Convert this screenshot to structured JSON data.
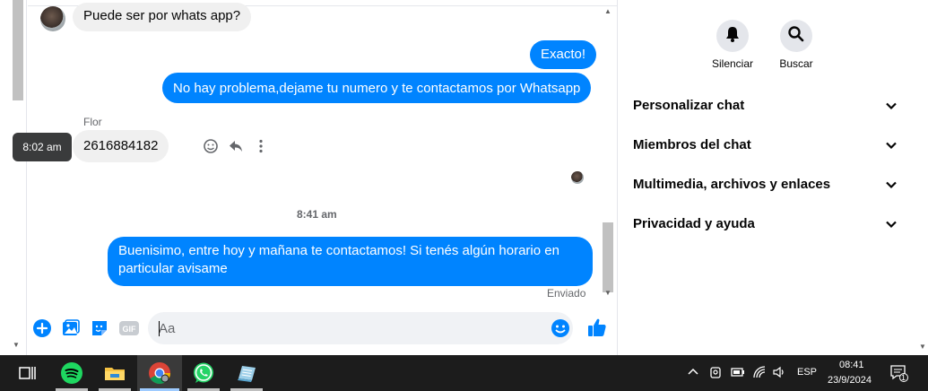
{
  "messages": {
    "in_first": "Puede ser por whats app?",
    "out_exacto": "Exacto!",
    "out_no_problema": "No hay problema,dejame tu numero y te contactamos por Whatsapp",
    "sender_flor": "Flor",
    "in_number": "2616884182",
    "tooltip_time": "8:02 am",
    "timestamp": "8:41 am",
    "out_last_line1": "Buenisimo, entre hoy y mañana te contactamos! Si tenés algún horario en",
    "out_last_line2": "particular avisame",
    "status": "Enviado"
  },
  "composer": {
    "placeholder": "Aa",
    "gif_label": "GIF"
  },
  "sidebar": {
    "mute_label": "Silenciar",
    "search_label": "Buscar",
    "items": [
      {
        "label": "Personalizar chat"
      },
      {
        "label": "Miembros del chat"
      },
      {
        "label": "Multimedia, archivos y enlaces"
      },
      {
        "label": "Privacidad y ayuda"
      }
    ]
  },
  "taskbar": {
    "lang": "ESP",
    "time": "08:41",
    "date": "23/9/2024",
    "notif_count": "1"
  },
  "colors": {
    "accent": "#0084ff",
    "bubble_in": "#f0f0f0",
    "taskbar": "#1c1c1c"
  }
}
